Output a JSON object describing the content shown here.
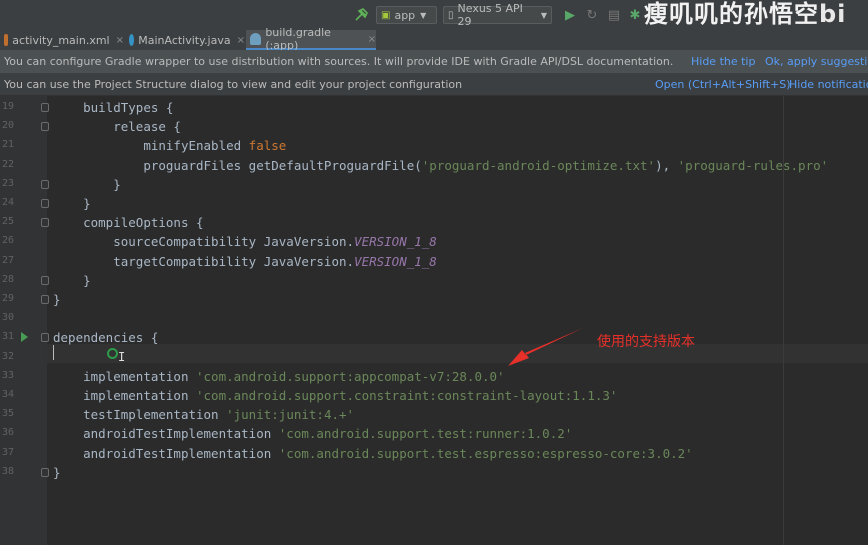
{
  "toolbar": {
    "run_config": "app",
    "device": "Nexus 5 API 29",
    "watermark": "瘦叽叽的孙悟空",
    "watermark_suffix": "bi"
  },
  "tabs": [
    {
      "label": "activity_main.xml",
      "close": "×",
      "icon_color": "#c16f2f"
    },
    {
      "label": "MainActivity.java",
      "close": "×",
      "icon_color": "#3592c4"
    },
    {
      "label": "build.gradle (:app)",
      "close": "×",
      "icon_color": "#6e9fbf"
    }
  ],
  "banner_tip": {
    "text": "You can configure Gradle wrapper to use distribution with sources. It will provide IDE with Gradle API/DSL documentation.",
    "action1": "Hide the tip",
    "action2": "Ok, apply suggestion"
  },
  "banner_psd": {
    "text": "You can use the Project Structure dialog to view and edit your project configuration",
    "action1": "Open (Ctrl+Alt+Shift+S)",
    "action2": "Hide notification"
  },
  "editor": {
    "line_numbers": [
      "19",
      "20",
      "21",
      "22",
      "23",
      "24",
      "25",
      "26",
      "27",
      "28",
      "29",
      "30",
      "31",
      "32",
      "33",
      "34",
      "35",
      "36",
      "37",
      "38"
    ],
    "lines": [
      {
        "indent": "    ",
        "parts": [
          {
            "t": "buildTypes {",
            "c": ""
          }
        ]
      },
      {
        "indent": "        ",
        "parts": [
          {
            "t": "release {",
            "c": ""
          }
        ]
      },
      {
        "indent": "            ",
        "parts": [
          {
            "t": "minifyEnabled ",
            "c": ""
          },
          {
            "t": "false",
            "c": "kw"
          }
        ]
      },
      {
        "indent": "            ",
        "parts": [
          {
            "t": "proguardFiles getDefaultProguardFile(",
            "c": ""
          },
          {
            "t": "'proguard-android-optimize.txt'",
            "c": "str"
          },
          {
            "t": "), ",
            "c": ""
          },
          {
            "t": "'proguard-rules.pro'",
            "c": "str"
          }
        ]
      },
      {
        "indent": "        ",
        "parts": [
          {
            "t": "}",
            "c": ""
          }
        ]
      },
      {
        "indent": "    ",
        "parts": [
          {
            "t": "}",
            "c": ""
          }
        ]
      },
      {
        "indent": "    ",
        "parts": [
          {
            "t": "compileOptions {",
            "c": ""
          }
        ]
      },
      {
        "indent": "        ",
        "parts": [
          {
            "t": "sourceCompatibility JavaVersion.",
            "c": ""
          },
          {
            "t": "VERSION_1_8",
            "c": "const"
          }
        ]
      },
      {
        "indent": "        ",
        "parts": [
          {
            "t": "targetCompatibility JavaVersion.",
            "c": ""
          },
          {
            "t": "VERSION_1_8",
            "c": "const"
          }
        ]
      },
      {
        "indent": "    ",
        "parts": [
          {
            "t": "}",
            "c": ""
          }
        ]
      },
      {
        "indent": "",
        "parts": [
          {
            "t": "}",
            "c": ""
          }
        ]
      },
      {
        "indent": "",
        "parts": []
      },
      {
        "indent": "",
        "parts": [
          {
            "t": "dependencies {",
            "c": ""
          }
        ]
      },
      {
        "indent": "",
        "parts": []
      },
      {
        "indent": "    ",
        "parts": [
          {
            "t": "implementation ",
            "c": ""
          },
          {
            "t": "'com.android.support:appcompat-v7:28.0.0'",
            "c": "str"
          }
        ]
      },
      {
        "indent": "    ",
        "parts": [
          {
            "t": "implementation ",
            "c": ""
          },
          {
            "t": "'com.android.support.constraint:constraint-layout:1.1.3'",
            "c": "str"
          }
        ]
      },
      {
        "indent": "    ",
        "parts": [
          {
            "t": "testImplementation ",
            "c": ""
          },
          {
            "t": "'junit:junit:4.+'",
            "c": "str"
          }
        ]
      },
      {
        "indent": "    ",
        "parts": [
          {
            "t": "androidTestImplementation ",
            "c": ""
          },
          {
            "t": "'com.android.support.test:runner:1.0.2'",
            "c": "str"
          }
        ]
      },
      {
        "indent": "    ",
        "parts": [
          {
            "t": "androidTestImplementation ",
            "c": ""
          },
          {
            "t": "'com.android.support.test.espresso:espresso-core:3.0.2'",
            "c": "str"
          }
        ]
      },
      {
        "indent": "",
        "parts": [
          {
            "t": "}",
            "c": ""
          }
        ]
      }
    ]
  },
  "annotation": {
    "text": "使用的支持版本",
    "color": "#e8302a"
  },
  "icons": {
    "hammer": "hammer-icon",
    "run": "run-icon",
    "rerun": "rerun-icon",
    "stop": "stop-icon",
    "debug": "debug-icon",
    "gradle_tab": "gradle-elephant-icon"
  }
}
